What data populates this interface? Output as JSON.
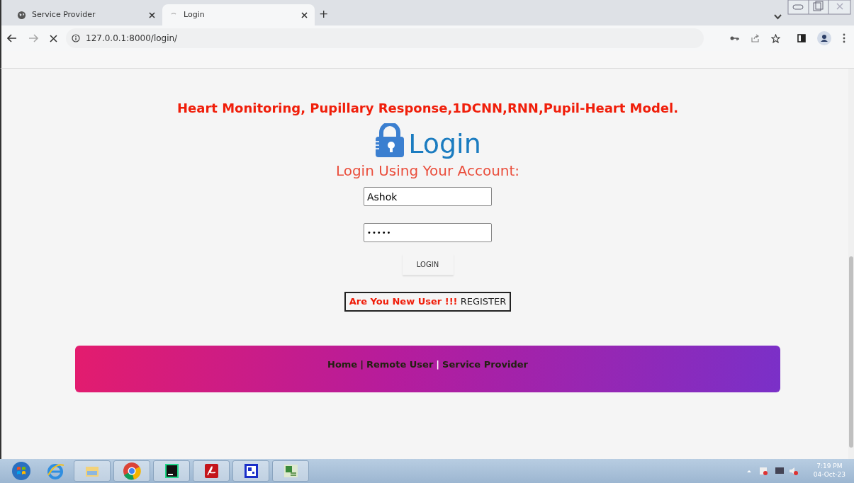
{
  "browser": {
    "tabs": [
      {
        "title": "Service Provider",
        "selected": false,
        "loading": false
      },
      {
        "title": "Login",
        "selected": true,
        "loading": true
      }
    ],
    "new_tab": "+",
    "address": "127.0.0.1:8000/login/"
  },
  "page": {
    "heading": "Heart Monitoring, Pupillary Response,1DCNN,RNN,Pupil-Heart Model.",
    "logo_text": "Login",
    "subtitle": "Login Using Your Account:",
    "fields": [
      {
        "kind": "text",
        "value": "Ashok"
      },
      {
        "kind": "password",
        "value": "•••••"
      }
    ],
    "button": "LOGIN",
    "register": {
      "prompt": "Are You New User !!!",
      "link": "REGISTER"
    },
    "footer": [
      {
        "kind": "link",
        "text": "Home"
      },
      {
        "kind": "separator",
        "text": "|",
        "light": false
      },
      {
        "kind": "link",
        "text": "Remote User"
      },
      {
        "kind": "separator",
        "text": "|",
        "light": true
      },
      {
        "kind": "link",
        "text": "Service Provider"
      }
    ]
  },
  "taskbar": {
    "time": "7:19 PM",
    "date": "04-Oct-23"
  }
}
